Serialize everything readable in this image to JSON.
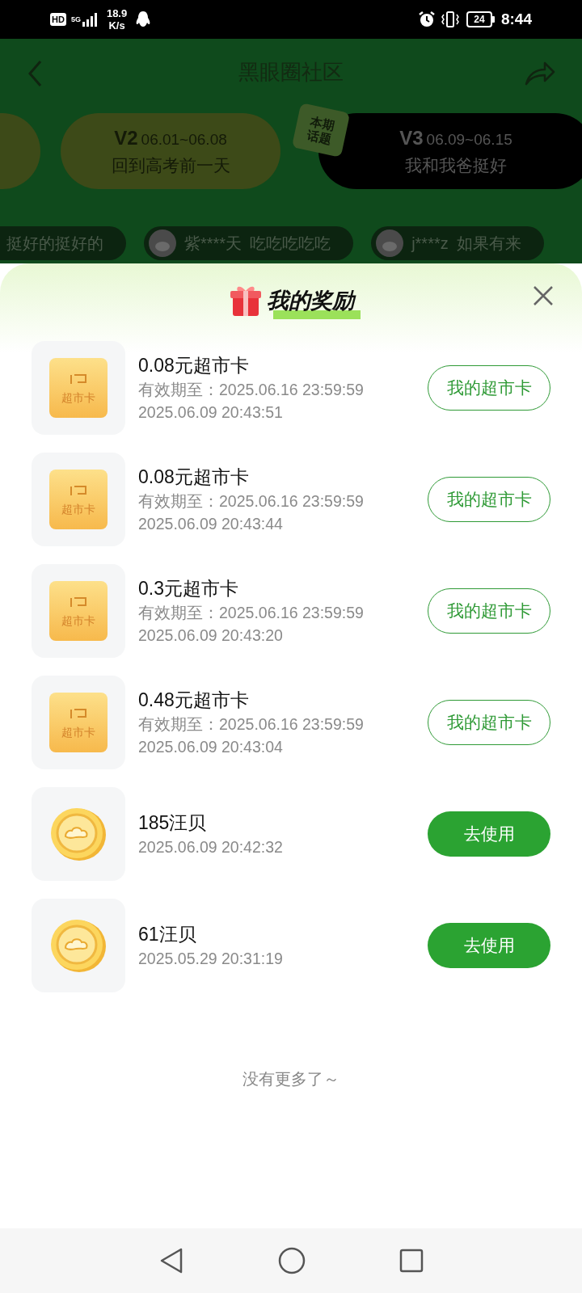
{
  "status_bar": {
    "hd": "HD",
    "network": "5G",
    "speed": "18.9",
    "speed_unit": "K/s",
    "battery": "24",
    "time": "8:44"
  },
  "header": {
    "title": "黑眼圈社区"
  },
  "topics": [
    {
      "version": "V2",
      "dates": "06.01~06.08",
      "name": "回到高考前一天",
      "selected": false
    },
    {
      "version": "V3",
      "dates": "06.09~06.15",
      "name": "我和我爸挺好",
      "selected": true,
      "badge": "本期话题"
    }
  ],
  "comments": [
    {
      "text": "挺好的挺好的"
    },
    {
      "user": "紫****天",
      "text": "吃吃吃吃吃"
    },
    {
      "user": "j****z",
      "text": "如果有来"
    }
  ],
  "rewards": {
    "title": "我的奖励",
    "items": [
      {
        "kind": "card",
        "icon_label": "超市卡",
        "name": "0.08元超市卡",
        "expiry": "有效期至：2025.06.16 23:59:59",
        "time": "2025.06.09 20:43:51",
        "button": "我的超市卡"
      },
      {
        "kind": "card",
        "icon_label": "超市卡",
        "name": "0.08元超市卡",
        "expiry": "有效期至：2025.06.16 23:59:59",
        "time": "2025.06.09 20:43:44",
        "button": "我的超市卡"
      },
      {
        "kind": "card",
        "icon_label": "超市卡",
        "name": "0.3元超市卡",
        "expiry": "有效期至：2025.06.16 23:59:59",
        "time": "2025.06.09 20:43:20",
        "button": "我的超市卡"
      },
      {
        "kind": "card",
        "icon_label": "超市卡",
        "name": "0.48元超市卡",
        "expiry": "有效期至：2025.06.16 23:59:59",
        "time": "2025.06.09 20:43:04",
        "button": "我的超市卡"
      },
      {
        "kind": "coin",
        "name": "185汪贝",
        "time": "2025.06.09 20:42:32",
        "button": "去使用"
      },
      {
        "kind": "coin",
        "name": "61汪贝",
        "time": "2025.05.29 20:31:19",
        "button": "去使用"
      }
    ],
    "footer": "没有更多了～"
  }
}
